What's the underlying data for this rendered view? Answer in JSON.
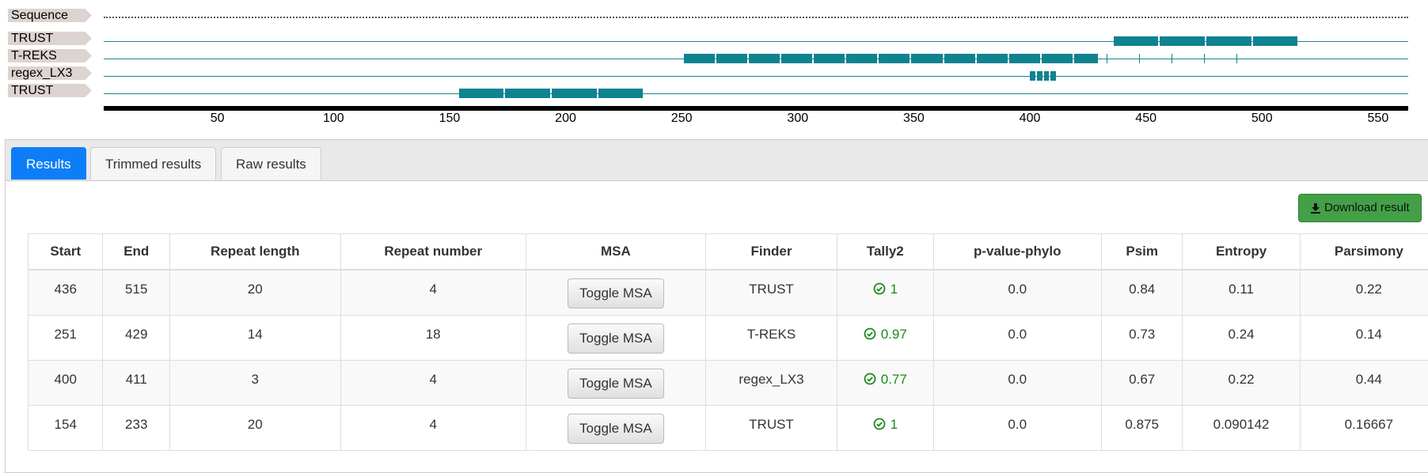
{
  "tracks": [
    {
      "label": "Sequence"
    },
    {
      "label": "TRUST"
    },
    {
      "label": "T-REKS"
    },
    {
      "label": "regex_LX3"
    },
    {
      "label": "TRUST"
    }
  ],
  "axis": {
    "range": [
      1,
      563
    ],
    "ticks": [
      "50",
      "100",
      "150",
      "200",
      "250",
      "300",
      "350",
      "400",
      "450",
      "500",
      "550"
    ]
  },
  "tabs": [
    "Results",
    "Trimmed results",
    "Raw results"
  ],
  "download_label": "Download result",
  "table": {
    "headers": [
      "Start",
      "End",
      "Repeat length",
      "Repeat number",
      "MSA",
      "Finder",
      "Tally2",
      "p-value-phylo",
      "Psim",
      "Entropy",
      "Parsimony"
    ],
    "msa_button_label": "Toggle MSA",
    "rows": [
      {
        "start": "436",
        "end": "515",
        "repeat_length": "20",
        "repeat_number": "4",
        "finder": "TRUST",
        "tally2": "1",
        "pvalue": "0.0",
        "psim": "0.84",
        "entropy": "0.11",
        "parsimony": "0.22"
      },
      {
        "start": "251",
        "end": "429",
        "repeat_length": "14",
        "repeat_number": "18",
        "finder": "T-REKS",
        "tally2": "0.97",
        "pvalue": "0.0",
        "psim": "0.73",
        "entropy": "0.24",
        "parsimony": "0.14"
      },
      {
        "start": "400",
        "end": "411",
        "repeat_length": "3",
        "repeat_number": "4",
        "finder": "regex_LX3",
        "tally2": "0.77",
        "pvalue": "0.0",
        "psim": "0.67",
        "entropy": "0.22",
        "parsimony": "0.44"
      },
      {
        "start": "154",
        "end": "233",
        "repeat_length": "20",
        "repeat_number": "4",
        "finder": "TRUST",
        "tally2": "1",
        "pvalue": "0.0",
        "psim": "0.875",
        "entropy": "0.090142",
        "parsimony": "0.16667"
      }
    ]
  },
  "colors": {
    "feature": "#0f8390",
    "track_line": "#19858a",
    "label_bg": "#ddd4d1",
    "active_tab": "#0d7ef7",
    "download_bg": "#43a047",
    "tally_ok": "#1a8a1a"
  },
  "icons": {
    "download": "download-icon",
    "tally": "check-circle-icon"
  }
}
